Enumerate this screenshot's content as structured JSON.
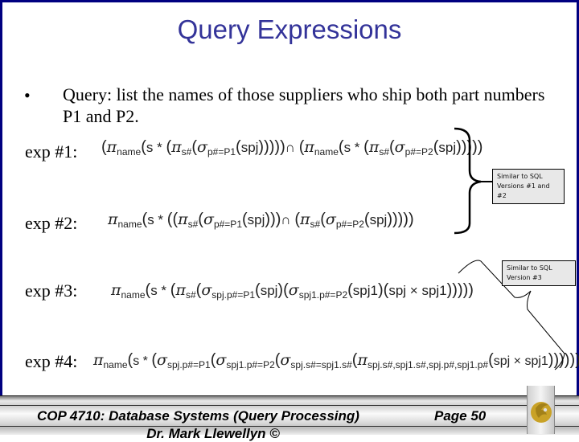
{
  "slide": {
    "title": "Query Expressions",
    "bullet_glyph": "•",
    "query_text": "Query:  list the names of those suppliers who ship both part numbers P1 and P2."
  },
  "expressions": [
    {
      "label": "exp #1:",
      "text": "(πname(s * (πs#(σp#=P1(spj))))) ∩ (πname(s * (πs#(σp#=P2(spj)))))"
    },
    {
      "label": "exp #2:",
      "text": "πname(s * ((πs#(σp#=P1(spj))) ∩ (πs#(σp#=P2(spj)))))"
    },
    {
      "label": "exp #3:",
      "text": "πname(s * (πs#(σspj.p#=P1(spj)(σspj1.p#=P2(spj1)(spj × spj1)))))"
    },
    {
      "label": "exp #4:",
      "text": "πname(s * (σspj.p#=P1(σspj1.p#=P2(σspj.s#=spj1.s#(πspj.s#,spj1.s#,spj.p#,spj1.p#(spj × spj1))))))"
    }
  ],
  "expr_parts": {
    "pi": "π",
    "sigma": "σ",
    "cap": "∩",
    "times": "×",
    "name": "name",
    "sharp": "s#",
    "s_star": "s *",
    "spj": "spj",
    "spj1": "spj1",
    "p1": "p#=P1",
    "p2": "p#=P2",
    "spj_p1": "spj.p#=P1",
    "spj1_p2": "spj1.p#=P2",
    "join_cond": "spj.s#=spj1.s#",
    "proj4": "spj.s#,spj1.s#,spj.p#,spj1.p#"
  },
  "callouts": {
    "sql12": {
      "line1": "Similar to SQL",
      "line2": "Versions #1 and",
      "line3": "#2"
    },
    "sql3": {
      "line1": "Similar to SQL",
      "line2": "Version #3"
    }
  },
  "footer": {
    "course": "COP 4710: Database Systems (Query Processing)",
    "page": "Page 50",
    "author": "Dr. Mark Llewellyn ©",
    "logo": "ucf-pegasus-logo"
  },
  "colors": {
    "border": "#000080",
    "title": "#333399",
    "logo_gold": "#c9a227"
  }
}
